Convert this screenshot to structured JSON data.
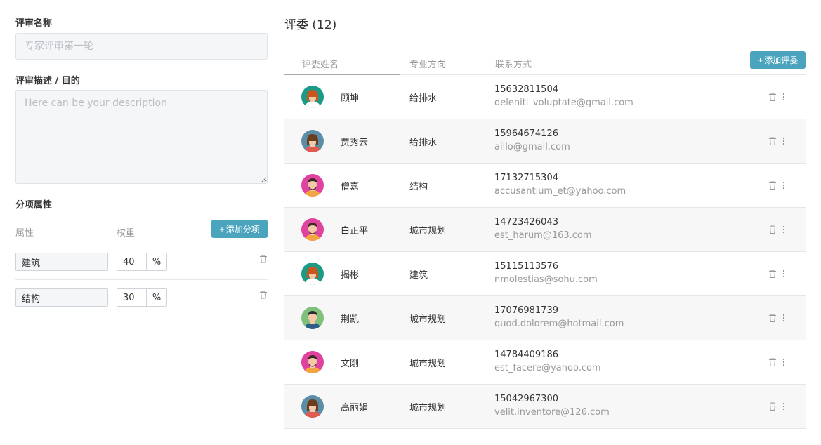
{
  "form": {
    "name_label": "评审名称",
    "name_placeholder": "专家评审第一轮",
    "desc_label": "评审描述 / 目的",
    "desc_placeholder": "Here can be your description",
    "items_label": "分项属性",
    "col_attr": "属性",
    "col_weight": "权重",
    "add_item_label": "添加分项",
    "items": [
      {
        "name": "建筑",
        "weight": "40",
        "unit": "%"
      },
      {
        "name": "结构",
        "weight": "30",
        "unit": "%"
      }
    ]
  },
  "panel": {
    "title": "评委 (12)",
    "col_name": "评委姓名",
    "col_dept": "专业方向",
    "col_contact": "联系方式",
    "add_label": "添加评委",
    "reviewers": [
      {
        "name": "顾坤",
        "dept": "给排水",
        "phone": "15632811504",
        "email": "deleniti_voluptate@gmail.com",
        "avatar_bg": "#1a9a87",
        "avatar_style": "woman-orange"
      },
      {
        "name": "贾秀云",
        "dept": "给排水",
        "phone": "15964674126",
        "email": "aillo@gmail.com",
        "avatar_bg": "#5b8ea6",
        "avatar_style": "woman-brown"
      },
      {
        "name": "僧嘉",
        "dept": "结构",
        "phone": "17132715304",
        "email": "accusantium_et@yahoo.com",
        "avatar_bg": "#e0439f",
        "avatar_style": "man-beard"
      },
      {
        "name": "白正平",
        "dept": "城市规划",
        "phone": "14723426043",
        "email": "est_harum@163.com",
        "avatar_bg": "#e0439f",
        "avatar_style": "man-beard"
      },
      {
        "name": "揭彬",
        "dept": "建筑",
        "phone": "15115113576",
        "email": "nmolestias@sohu.com",
        "avatar_bg": "#1a9a87",
        "avatar_style": "woman-orange"
      },
      {
        "name": "荆凯",
        "dept": "城市规划",
        "phone": "17076981739",
        "email": "quod.dolorem@hotmail.com",
        "avatar_bg": "#7fc07a",
        "avatar_style": "man-dark"
      },
      {
        "name": "文刚",
        "dept": "城市规划",
        "phone": "14784409186",
        "email": "est_facere@yahoo.com",
        "avatar_bg": "#e0439f",
        "avatar_style": "man-beard"
      },
      {
        "name": "高丽娟",
        "dept": "城市规划",
        "phone": "15042967300",
        "email": "velit.inventore@126.com",
        "avatar_bg": "#5b8ea6",
        "avatar_style": "woman-brown"
      }
    ]
  }
}
